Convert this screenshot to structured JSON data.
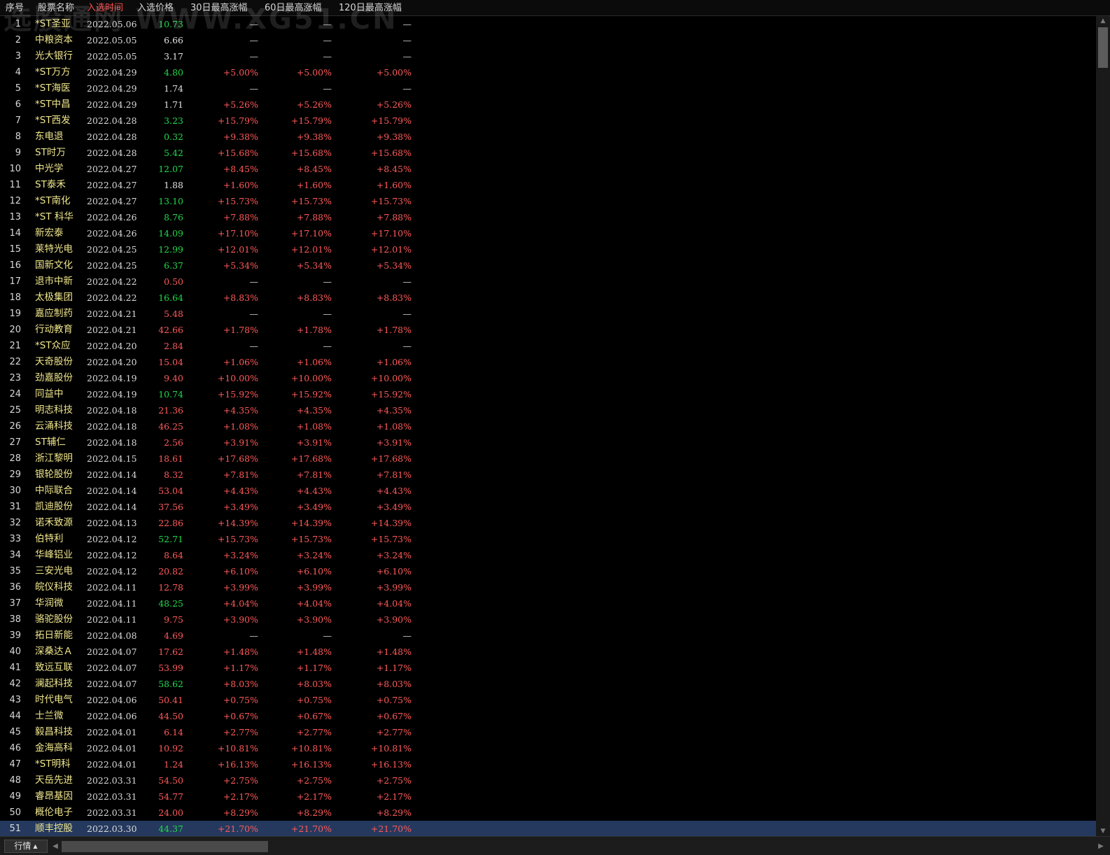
{
  "header": {
    "columns": [
      "序号",
      "股票名称",
      "入选时间",
      "入选价格",
      "30日最高涨幅",
      "60日最高涨幅",
      "120日最高涨幅"
    ],
    "active_column": "入选时间"
  },
  "watermark": "选股通网  WWW.XG51.CN",
  "colors": {
    "background": "#000000",
    "name": "#f0e68c",
    "up": "#ff5a5a",
    "down": "#22d84a",
    "flat": "#e0e0e0",
    "active_header": "#ff4d4d",
    "selected_row": "#25395e"
  },
  "rows": [
    {
      "seq": "1",
      "name": "*ST圣亚",
      "date": "2022.05.06",
      "price": "10.73",
      "pc": "down",
      "g30": "—",
      "g60": "—",
      "g120": "—"
    },
    {
      "seq": "2",
      "name": "中粮资本",
      "date": "2022.05.05",
      "price": "6.66",
      "pc": "flat",
      "g30": "—",
      "g60": "—",
      "g120": "—"
    },
    {
      "seq": "3",
      "name": "光大银行",
      "date": "2022.05.05",
      "price": "3.17",
      "pc": "flat",
      "g30": "—",
      "g60": "—",
      "g120": "—"
    },
    {
      "seq": "4",
      "name": "*ST万方",
      "date": "2022.04.29",
      "price": "4.80",
      "pc": "down",
      "g30": "+5.00%",
      "g60": "+5.00%",
      "g120": "+5.00%"
    },
    {
      "seq": "5",
      "name": "*ST海医",
      "date": "2022.04.29",
      "price": "1.74",
      "pc": "flat",
      "g30": "—",
      "g60": "—",
      "g120": "—"
    },
    {
      "seq": "6",
      "name": "*ST中昌",
      "date": "2022.04.29",
      "price": "1.71",
      "pc": "flat",
      "g30": "+5.26%",
      "g60": "+5.26%",
      "g120": "+5.26%"
    },
    {
      "seq": "7",
      "name": "*ST西发",
      "date": "2022.04.28",
      "price": "3.23",
      "pc": "down",
      "g30": "+15.79%",
      "g60": "+15.79%",
      "g120": "+15.79%"
    },
    {
      "seq": "8",
      "name": "东电退",
      "date": "2022.04.28",
      "price": "0.32",
      "pc": "down",
      "g30": "+9.38%",
      "g60": "+9.38%",
      "g120": "+9.38%"
    },
    {
      "seq": "9",
      "name": "ST时万",
      "date": "2022.04.28",
      "price": "5.42",
      "pc": "down",
      "g30": "+15.68%",
      "g60": "+15.68%",
      "g120": "+15.68%"
    },
    {
      "seq": "10",
      "name": "中光学",
      "date": "2022.04.27",
      "price": "12.07",
      "pc": "down",
      "g30": "+8.45%",
      "g60": "+8.45%",
      "g120": "+8.45%"
    },
    {
      "seq": "11",
      "name": "ST泰禾",
      "date": "2022.04.27",
      "price": "1.88",
      "pc": "flat",
      "g30": "+1.60%",
      "g60": "+1.60%",
      "g120": "+1.60%"
    },
    {
      "seq": "12",
      "name": "*ST南化",
      "date": "2022.04.27",
      "price": "13.10",
      "pc": "down",
      "g30": "+15.73%",
      "g60": "+15.73%",
      "g120": "+15.73%"
    },
    {
      "seq": "13",
      "name": "*ST 科华",
      "date": "2022.04.26",
      "price": "8.76",
      "pc": "down",
      "g30": "+7.88%",
      "g60": "+7.88%",
      "g120": "+7.88%"
    },
    {
      "seq": "14",
      "name": "新宏泰",
      "date": "2022.04.26",
      "price": "14.09",
      "pc": "down",
      "g30": "+17.10%",
      "g60": "+17.10%",
      "g120": "+17.10%"
    },
    {
      "seq": "15",
      "name": "莱特光电",
      "date": "2022.04.25",
      "price": "12.99",
      "pc": "down",
      "g30": "+12.01%",
      "g60": "+12.01%",
      "g120": "+12.01%"
    },
    {
      "seq": "16",
      "name": "国新文化",
      "date": "2022.04.25",
      "price": "6.37",
      "pc": "down",
      "g30": "+5.34%",
      "g60": "+5.34%",
      "g120": "+5.34%"
    },
    {
      "seq": "17",
      "name": "退市中新",
      "date": "2022.04.22",
      "price": "0.50",
      "pc": "up",
      "g30": "—",
      "g60": "—",
      "g120": "—"
    },
    {
      "seq": "18",
      "name": "太极集团",
      "date": "2022.04.22",
      "price": "16.64",
      "pc": "down",
      "g30": "+8.83%",
      "g60": "+8.83%",
      "g120": "+8.83%"
    },
    {
      "seq": "19",
      "name": "嘉应制药",
      "date": "2022.04.21",
      "price": "5.48",
      "pc": "up",
      "g30": "—",
      "g60": "—",
      "g120": "—"
    },
    {
      "seq": "20",
      "name": "行动教育",
      "date": "2022.04.21",
      "price": "42.66",
      "pc": "up",
      "g30": "+1.78%",
      "g60": "+1.78%",
      "g120": "+1.78%"
    },
    {
      "seq": "21",
      "name": "*ST众应",
      "date": "2022.04.20",
      "price": "2.84",
      "pc": "up",
      "g30": "—",
      "g60": "—",
      "g120": "—"
    },
    {
      "seq": "22",
      "name": "天奇股份",
      "date": "2022.04.20",
      "price": "15.04",
      "pc": "up",
      "g30": "+1.06%",
      "g60": "+1.06%",
      "g120": "+1.06%"
    },
    {
      "seq": "23",
      "name": "劲嘉股份",
      "date": "2022.04.19",
      "price": "9.40",
      "pc": "up",
      "g30": "+10.00%",
      "g60": "+10.00%",
      "g120": "+10.00%"
    },
    {
      "seq": "24",
      "name": "同益中",
      "date": "2022.04.19",
      "price": "10.74",
      "pc": "down",
      "g30": "+15.92%",
      "g60": "+15.92%",
      "g120": "+15.92%"
    },
    {
      "seq": "25",
      "name": "明志科技",
      "date": "2022.04.18",
      "price": "21.36",
      "pc": "up",
      "g30": "+4.35%",
      "g60": "+4.35%",
      "g120": "+4.35%"
    },
    {
      "seq": "26",
      "name": "云涌科技",
      "date": "2022.04.18",
      "price": "46.25",
      "pc": "up",
      "g30": "+1.08%",
      "g60": "+1.08%",
      "g120": "+1.08%"
    },
    {
      "seq": "27",
      "name": "ST辅仁",
      "date": "2022.04.18",
      "price": "2.56",
      "pc": "up",
      "g30": "+3.91%",
      "g60": "+3.91%",
      "g120": "+3.91%"
    },
    {
      "seq": "28",
      "name": "浙江黎明",
      "date": "2022.04.15",
      "price": "18.61",
      "pc": "up",
      "g30": "+17.68%",
      "g60": "+17.68%",
      "g120": "+17.68%"
    },
    {
      "seq": "29",
      "name": "银轮股份",
      "date": "2022.04.14",
      "price": "8.32",
      "pc": "up",
      "g30": "+7.81%",
      "g60": "+7.81%",
      "g120": "+7.81%"
    },
    {
      "seq": "30",
      "name": "中际联合",
      "date": "2022.04.14",
      "price": "53.04",
      "pc": "up",
      "g30": "+4.43%",
      "g60": "+4.43%",
      "g120": "+4.43%"
    },
    {
      "seq": "31",
      "name": "凯迪股份",
      "date": "2022.04.14",
      "price": "37.56",
      "pc": "up",
      "g30": "+3.49%",
      "g60": "+3.49%",
      "g120": "+3.49%"
    },
    {
      "seq": "32",
      "name": "诺禾致源",
      "date": "2022.04.13",
      "price": "22.86",
      "pc": "up",
      "g30": "+14.39%",
      "g60": "+14.39%",
      "g120": "+14.39%"
    },
    {
      "seq": "33",
      "name": "伯特利",
      "date": "2022.04.12",
      "price": "52.71",
      "pc": "down",
      "g30": "+15.73%",
      "g60": "+15.73%",
      "g120": "+15.73%"
    },
    {
      "seq": "34",
      "name": "华峰铝业",
      "date": "2022.04.12",
      "price": "8.64",
      "pc": "up",
      "g30": "+3.24%",
      "g60": "+3.24%",
      "g120": "+3.24%"
    },
    {
      "seq": "35",
      "name": "三安光电",
      "date": "2022.04.12",
      "price": "20.82",
      "pc": "up",
      "g30": "+6.10%",
      "g60": "+6.10%",
      "g120": "+6.10%"
    },
    {
      "seq": "36",
      "name": "皖仪科技",
      "date": "2022.04.11",
      "price": "12.78",
      "pc": "up",
      "g30": "+3.99%",
      "g60": "+3.99%",
      "g120": "+3.99%"
    },
    {
      "seq": "37",
      "name": "华润微",
      "date": "2022.04.11",
      "price": "48.25",
      "pc": "down",
      "g30": "+4.04%",
      "g60": "+4.04%",
      "g120": "+4.04%"
    },
    {
      "seq": "38",
      "name": "骆驼股份",
      "date": "2022.04.11",
      "price": "9.75",
      "pc": "up",
      "g30": "+3.90%",
      "g60": "+3.90%",
      "g120": "+3.90%"
    },
    {
      "seq": "39",
      "name": "拓日新能",
      "date": "2022.04.08",
      "price": "4.69",
      "pc": "up",
      "g30": "—",
      "g60": "—",
      "g120": "—"
    },
    {
      "seq": "40",
      "name": "深桑达Ａ",
      "date": "2022.04.07",
      "price": "17.62",
      "pc": "up",
      "g30": "+1.48%",
      "g60": "+1.48%",
      "g120": "+1.48%"
    },
    {
      "seq": "41",
      "name": "致远互联",
      "date": "2022.04.07",
      "price": "53.99",
      "pc": "up",
      "g30": "+1.17%",
      "g60": "+1.17%",
      "g120": "+1.17%"
    },
    {
      "seq": "42",
      "name": "澜起科技",
      "date": "2022.04.07",
      "price": "58.62",
      "pc": "down",
      "g30": "+8.03%",
      "g60": "+8.03%",
      "g120": "+8.03%"
    },
    {
      "seq": "43",
      "name": "时代电气",
      "date": "2022.04.06",
      "price": "50.41",
      "pc": "up",
      "g30": "+0.75%",
      "g60": "+0.75%",
      "g120": "+0.75%"
    },
    {
      "seq": "44",
      "name": "士兰微",
      "date": "2022.04.06",
      "price": "44.50",
      "pc": "up",
      "g30": "+0.67%",
      "g60": "+0.67%",
      "g120": "+0.67%"
    },
    {
      "seq": "45",
      "name": "毅昌科技",
      "date": "2022.04.01",
      "price": "6.14",
      "pc": "up",
      "g30": "+2.77%",
      "g60": "+2.77%",
      "g120": "+2.77%"
    },
    {
      "seq": "46",
      "name": "金海高科",
      "date": "2022.04.01",
      "price": "10.92",
      "pc": "up",
      "g30": "+10.81%",
      "g60": "+10.81%",
      "g120": "+10.81%"
    },
    {
      "seq": "47",
      "name": "*ST明科",
      "date": "2022.04.01",
      "price": "1.24",
      "pc": "up",
      "g30": "+16.13%",
      "g60": "+16.13%",
      "g120": "+16.13%"
    },
    {
      "seq": "48",
      "name": "天岳先进",
      "date": "2022.03.31",
      "price": "54.50",
      "pc": "up",
      "g30": "+2.75%",
      "g60": "+2.75%",
      "g120": "+2.75%"
    },
    {
      "seq": "49",
      "name": "睿昂基因",
      "date": "2022.03.31",
      "price": "54.77",
      "pc": "up",
      "g30": "+2.17%",
      "g60": "+2.17%",
      "g120": "+2.17%"
    },
    {
      "seq": "50",
      "name": "概伦电子",
      "date": "2022.03.31",
      "price": "24.00",
      "pc": "up",
      "g30": "+8.29%",
      "g60": "+8.29%",
      "g120": "+8.29%"
    },
    {
      "seq": "51",
      "name": "顺丰控股",
      "date": "2022.03.30",
      "price": "44.37",
      "pc": "down",
      "g30": "+21.70%",
      "g60": "+21.70%",
      "g120": "+21.70%",
      "selected": true
    }
  ],
  "bottom": {
    "tab_label": "行情",
    "tab_arrow": "▲",
    "scroll_left": "◀",
    "scroll_right": "▶",
    "scroll_up": "▲",
    "scroll_down": "▼"
  }
}
